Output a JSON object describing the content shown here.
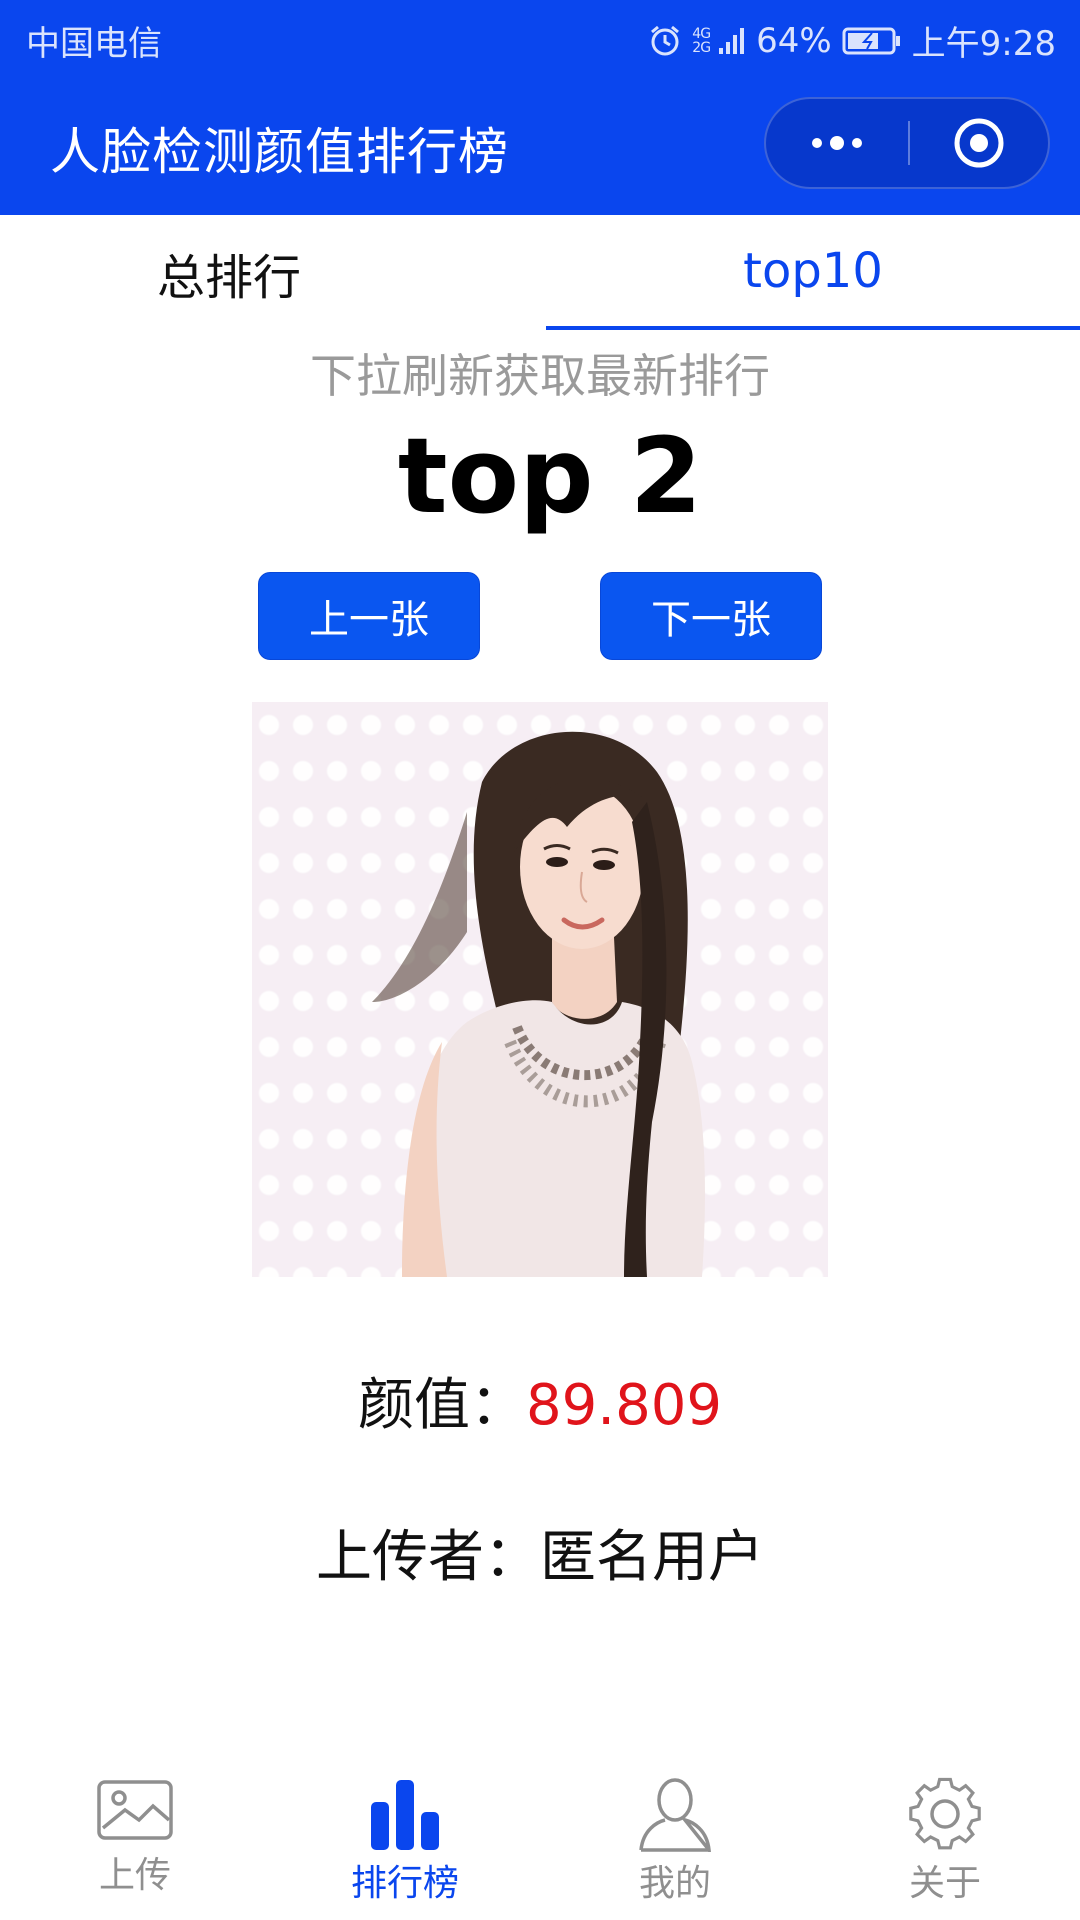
{
  "status_bar": {
    "carrier": "中国电信",
    "network_top": "4G",
    "network_bottom": "2G",
    "battery": "64%",
    "time": "上午9:28"
  },
  "header": {
    "title": "人脸检测颜值排行榜"
  },
  "tabs": [
    {
      "label": "总排行",
      "active": false
    },
    {
      "label": "top10",
      "active": true
    }
  ],
  "refresh_hint": "下拉刷新获取最新排行",
  "rank_title": "top 2",
  "buttons": {
    "prev_label": "上一张",
    "next_label": "下一张"
  },
  "result": {
    "score_label": "颜值：",
    "score_value": "89.809",
    "uploader_label": "上传者：",
    "uploader_name": "匿名用户"
  },
  "tabbar": [
    {
      "label": "上传",
      "icon": "image-icon",
      "active": false
    },
    {
      "label": "排行榜",
      "icon": "bar-chart-icon",
      "active": true
    },
    {
      "label": "我的",
      "icon": "user-icon",
      "active": false
    },
    {
      "label": "关于",
      "icon": "gear-icon",
      "active": false
    }
  ],
  "colors": {
    "brand_blue": "#0a46ee",
    "score_red": "#e0141b",
    "inactive_gray": "#8f8f8f"
  }
}
